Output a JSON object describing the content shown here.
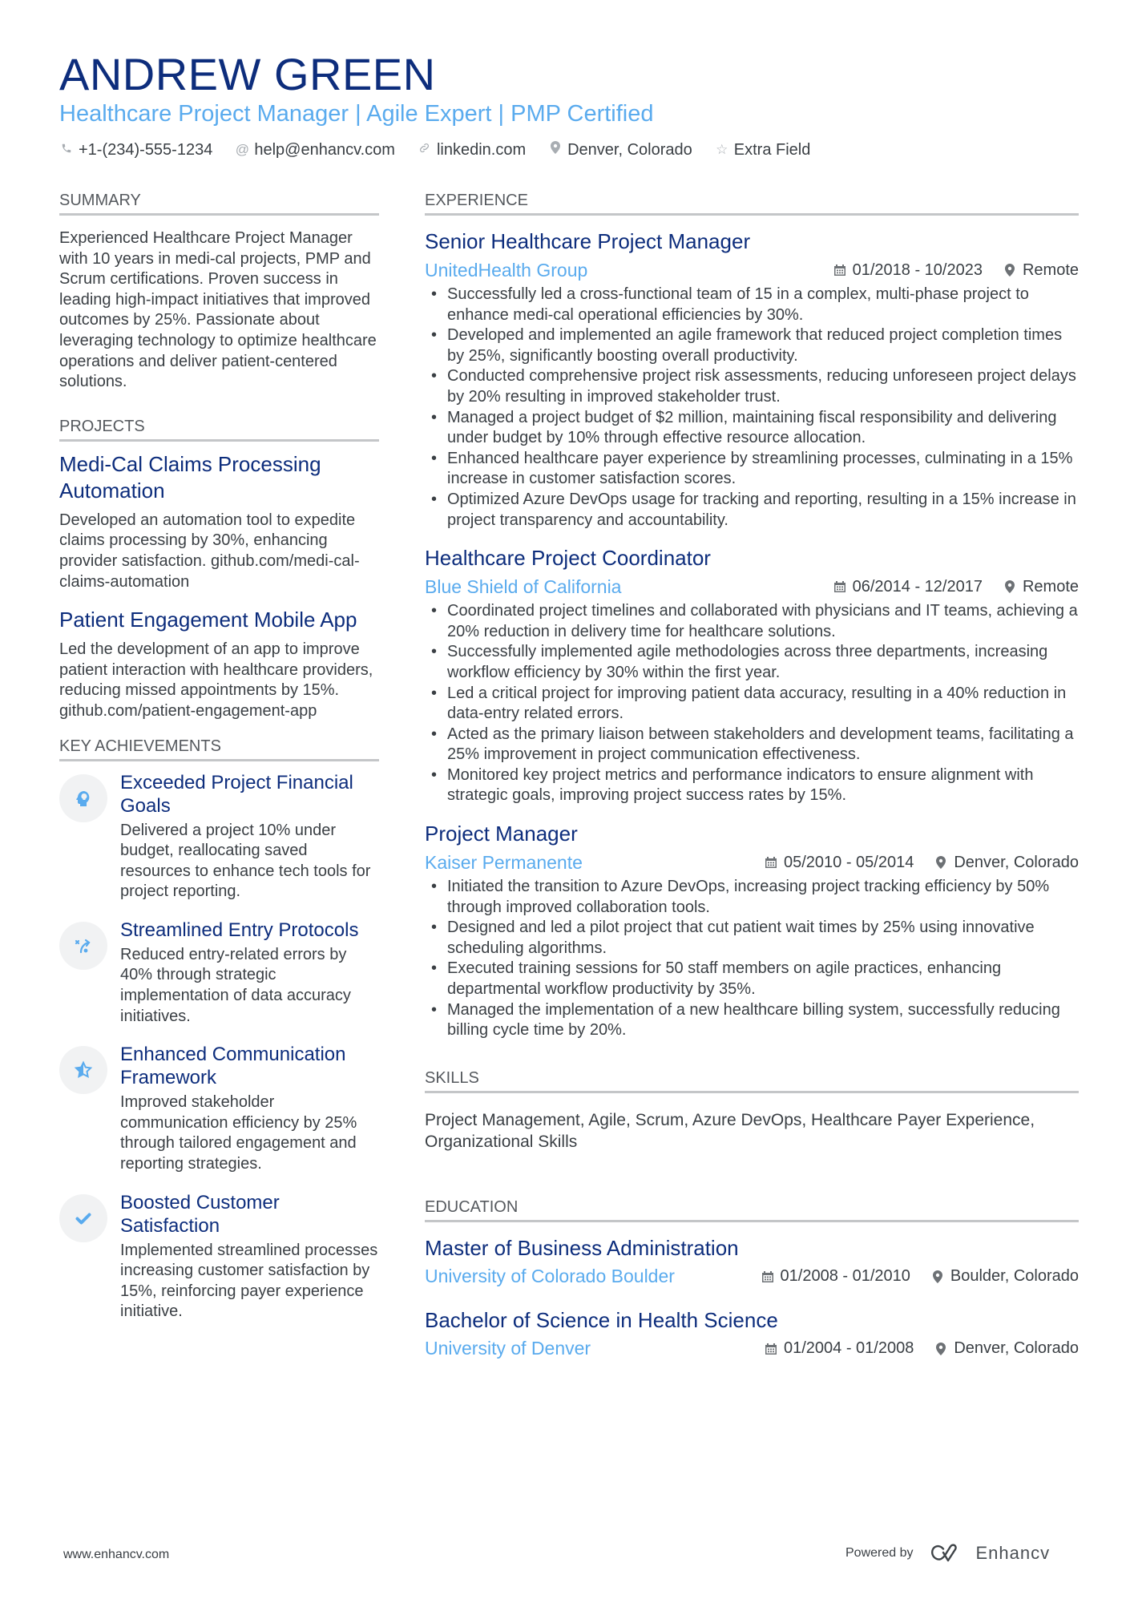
{
  "header": {
    "name": "ANDREW GREEN",
    "subtitle": "Healthcare Project Manager | Agile Expert | PMP Certified",
    "contacts": [
      {
        "icon": "phone-icon",
        "text": "+1-(234)-555-1234"
      },
      {
        "icon": "at-icon",
        "text": "help@enhancv.com"
      },
      {
        "icon": "link-icon",
        "text": "linkedin.com"
      },
      {
        "icon": "location-pin-icon",
        "text": "Denver, Colorado"
      },
      {
        "icon": "star-icon",
        "text": "Extra Field"
      }
    ]
  },
  "summary": {
    "title": "SUMMARY",
    "text": "Experienced Healthcare Project Manager with 10 years in medi-cal projects, PMP and Scrum certifications. Proven success in leading high-impact initiatives that improved outcomes by 25%. Passionate about leveraging technology to optimize healthcare operations and deliver patient-centered solutions."
  },
  "projects": {
    "title": "PROJECTS",
    "items": [
      {
        "title": "Medi-Cal Claims Processing Automation",
        "description": "Developed an automation tool to expedite claims processing by 30%, enhancing provider satisfaction. github.com/medi-cal-claims-automation"
      },
      {
        "title": "Patient Engagement Mobile App",
        "description": "Led the development of an app to improve patient interaction with healthcare providers, reducing missed appointments by 15%. github.com/patient-engagement-app"
      }
    ]
  },
  "achievements": {
    "title": "KEY ACHIEVEMENTS",
    "items": [
      {
        "icon": "head-brain-icon",
        "title": "Exceeded Project Financial Goals",
        "description": "Delivered a project 10% under budget, reallocating saved resources to enhance tech tools for project reporting."
      },
      {
        "icon": "strategy-path-icon",
        "title": "Streamlined Entry Protocols",
        "description": "Reduced entry-related errors by 40% through strategic implementation of data accuracy initiatives."
      },
      {
        "icon": "half-star-icon",
        "title": "Enhanced Communication Framework",
        "description": "Improved stakeholder communication efficiency by 25% through tailored engagement and reporting strategies."
      },
      {
        "icon": "checkmark-icon",
        "title": "Boosted Customer Satisfaction",
        "description": "Implemented streamlined processes increasing customer satisfaction by 15%, reinforcing payer experience initiative."
      }
    ]
  },
  "experience": {
    "title": "EXPERIENCE",
    "jobs": [
      {
        "title": "Senior Healthcare Project Manager",
        "company": "UnitedHealth Group",
        "dates": "01/2018 - 10/2023",
        "location": "Remote",
        "bullets": [
          "Successfully led a cross-functional team of 15 in a complex, multi-phase project to enhance medi-cal operational efficiencies by 30%.",
          "Developed and implemented an agile framework that reduced project completion times by 25%, significantly boosting overall productivity.",
          "Conducted comprehensive project risk assessments, reducing unforeseen project delays by 20% resulting in improved stakeholder trust.",
          "Managed a project budget of $2 million, maintaining fiscal responsibility and delivering under budget by 10% through effective resource allocation.",
          "Enhanced healthcare payer experience by streamlining processes, culminating in a 15% increase in customer satisfaction scores.",
          "Optimized Azure DevOps usage for tracking and reporting, resulting in a 15% increase in project transparency and accountability."
        ]
      },
      {
        "title": "Healthcare Project Coordinator",
        "company": "Blue Shield of California",
        "dates": "06/2014 - 12/2017",
        "location": "Remote",
        "bullets": [
          "Coordinated project timelines and collaborated with physicians and IT teams, achieving a 20% reduction in delivery time for healthcare solutions.",
          "Successfully implemented agile methodologies across three departments, increasing workflow efficiency by 30% within the first year.",
          "Led a critical project for improving patient data accuracy, resulting in a 40% reduction in data-entry related errors.",
          "Acted as the primary liaison between stakeholders and development teams, facilitating a 25% improvement in project communication effectiveness.",
          "Monitored key project metrics and performance indicators to ensure alignment with strategic goals, improving project success rates by 15%."
        ]
      },
      {
        "title": "Project Manager",
        "company": "Kaiser Permanente",
        "dates": "05/2010 - 05/2014",
        "location": "Denver, Colorado",
        "bullets": [
          "Initiated the transition to Azure DevOps, increasing project tracking efficiency by 50% through improved collaboration tools.",
          "Designed and led a pilot project that cut patient wait times by 25% using innovative scheduling algorithms.",
          "Executed training sessions for 50 staff members on agile practices, enhancing departmental workflow productivity by 35%.",
          "Managed the implementation of a new healthcare billing system, successfully reducing billing cycle time by 20%."
        ]
      }
    ]
  },
  "skills": {
    "title": "SKILLS",
    "text": "Project Management, Agile, Scrum, Azure DevOps, Healthcare Payer Experience, Organizational Skills"
  },
  "education": {
    "title": "EDUCATION",
    "items": [
      {
        "degree": "Master of Business Administration",
        "school": "University of Colorado Boulder",
        "dates": "01/2008 - 01/2010",
        "location": "Boulder, Colorado"
      },
      {
        "degree": "Bachelor of Science in Health Science",
        "school": "University of Denver",
        "dates": "01/2004 - 01/2008",
        "location": "Denver, Colorado"
      }
    ]
  },
  "footer": {
    "website": "www.enhancv.com",
    "powered_by": "Powered by",
    "brand": "Enhancv"
  },
  "colors": {
    "primary": "#0d2d7c",
    "accent": "#5aabee",
    "text": "#3a3f44",
    "rule": "#c4c6c8"
  }
}
